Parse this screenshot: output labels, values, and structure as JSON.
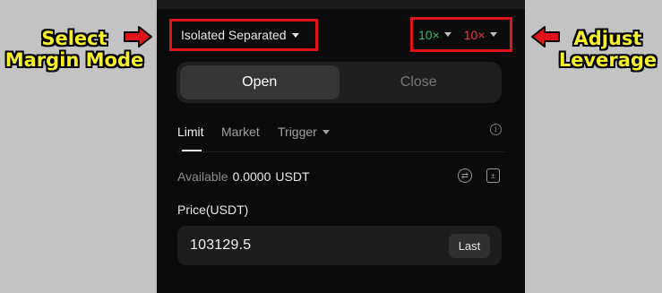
{
  "annotations": {
    "left_callout": [
      "Select",
      "Margin Mode"
    ],
    "right_callout": [
      "Adjust",
      "Leverage"
    ],
    "highlight_color": "#e0131b",
    "callout_color": "#f5f02a"
  },
  "header": {
    "margin_mode": "Isolated Separated",
    "leverage_long": "10×",
    "leverage_short": "10×",
    "long_color": "#2ebd6b",
    "short_color": "#f23645"
  },
  "tabs": [
    {
      "label": "Open",
      "active": true
    },
    {
      "label": "Close",
      "active": false
    }
  ],
  "order_types": {
    "limit": "Limit",
    "market": "Market",
    "trigger": "Trigger",
    "active": "Limit"
  },
  "balance": {
    "label": "Available",
    "amount": "0.0000",
    "currency": "USDT"
  },
  "price": {
    "label": "Price(USDT)",
    "value": "103129.5",
    "last_button": "Last"
  },
  "icons": [
    "info-icon",
    "swap-icon",
    "calculator-icon",
    "arrow-icon"
  ]
}
